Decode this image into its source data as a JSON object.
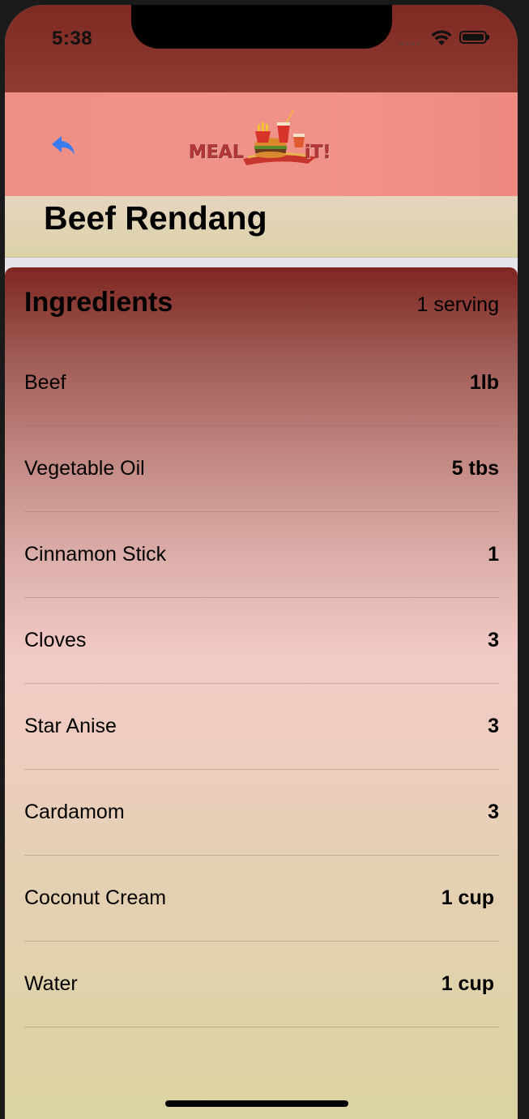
{
  "status_bar": {
    "time": "5:38"
  },
  "nav": {
    "back_icon": "back-arrow-icon",
    "logo_left": "MEAL",
    "logo_right": "iT!",
    "accent": "#3b7bf0"
  },
  "recipe": {
    "title": "Beef Rendang"
  },
  "ingredients": {
    "heading": "Ingredients",
    "serving": "1 serving",
    "items": [
      {
        "name": "Beef",
        "qty": "1lb"
      },
      {
        "name": "Vegetable Oil",
        "qty": "5 tbs"
      },
      {
        "name": "Cinnamon Stick",
        "qty": "1"
      },
      {
        "name": "Cloves",
        "qty": "3"
      },
      {
        "name": "Star Anise",
        "qty": "3"
      },
      {
        "name": "Cardamom",
        "qty": "3"
      },
      {
        "name": "Coconut Cream",
        "qty": "1 cup"
      },
      {
        "name": "Water",
        "qty": "1 cup"
      }
    ]
  },
  "colors": {
    "status_bar": "#8f3a33",
    "nav_bar": "#f19288",
    "card_top": "#7f2621",
    "card_bottom": "#dad3a1"
  }
}
